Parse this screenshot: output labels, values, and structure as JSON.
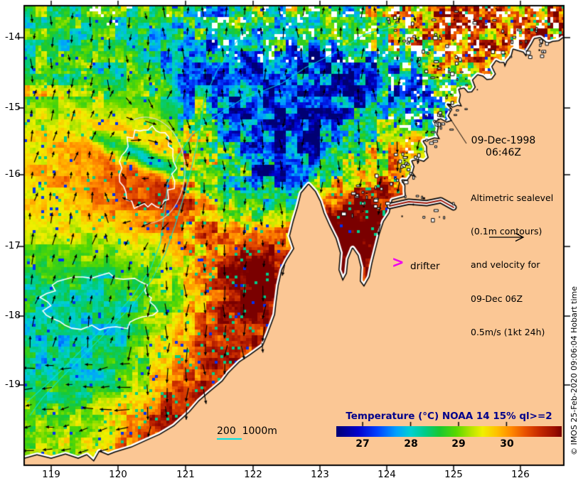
{
  "title_block": {
    "date": "09-Dec-1998",
    "time": "06:46Z"
  },
  "annotations": {
    "altimetric_lines": [
      "Altimetric sealevel",
      "(0.1m contours)",
      "and velocity for",
      "09-Dec 06Z",
      "0.5m/s (1kt 24h)"
    ],
    "drifter_label": "drifter",
    "drifter_marker_glyph": ">",
    "depth_contour_label": "200  1000m",
    "copyright_vertical": "© IMOS 25-Feb-2020 09:06:04 Hobart time"
  },
  "colorbar": {
    "title": "Temperature (°C) NOAA 14 15% ql>=2",
    "title_color": "#00008B",
    "tick_labels": [
      "27",
      "28",
      "29",
      "30"
    ],
    "tick_values": [
      27,
      28,
      29,
      30
    ],
    "range": [
      26.45,
      31.15
    ],
    "palette": [
      [
        26.45,
        "#000073"
      ],
      [
        26.9,
        "#0000CC"
      ],
      [
        27.3,
        "#0040FF"
      ],
      [
        27.7,
        "#00A0FF"
      ],
      [
        28.0,
        "#00D0D0"
      ],
      [
        28.3,
        "#00CC88"
      ],
      [
        28.6,
        "#18C832"
      ],
      [
        28.95,
        "#58D800"
      ],
      [
        29.25,
        "#B4E400"
      ],
      [
        29.5,
        "#F0F000"
      ],
      [
        29.8,
        "#FFC000"
      ],
      [
        30.1,
        "#FF8800"
      ],
      [
        30.4,
        "#E85000"
      ],
      [
        30.7,
        "#C42800"
      ],
      [
        31.0,
        "#9C0E00"
      ],
      [
        31.15,
        "#7A0000"
      ]
    ]
  },
  "axes": {
    "x_tick_labels": [
      "119",
      "120",
      "121",
      "122",
      "123",
      "124",
      "125",
      "126"
    ],
    "y_tick_labels": [
      "-14",
      "-15",
      "-16",
      "-17",
      "-18",
      "-19"
    ]
  },
  "colors": {
    "page_bg": "#FFFFFF",
    "land": "#FBC795",
    "coast_beach": "#FFFFFF",
    "coast_outline": "#000000",
    "contour_bathymetry": "#00E1E1",
    "contour_sealevel": "#FFFFFF",
    "drifter": "#EE00EE",
    "velocity_arrow": "#000000"
  }
}
